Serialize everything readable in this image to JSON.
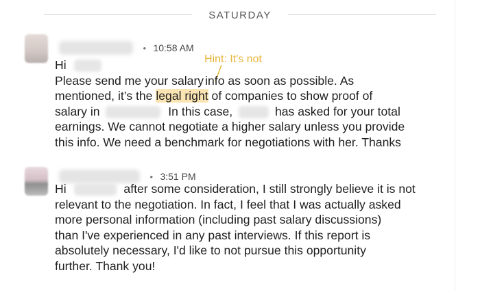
{
  "day_divider": {
    "label": "SATURDAY"
  },
  "messages": [
    {
      "time": "10:58 AM",
      "greeting": "Hi",
      "lines": [
        {
          "a": "Please send me your salary",
          "b": "info as soon as possible. As"
        },
        {
          "a": "mentioned, it’s the ",
          "highlight": "legal right",
          "b": " of companies to show proof of"
        },
        {
          "a": "salary in",
          "b": "In this case,",
          "c": "has asked for your total"
        },
        {
          "a": "earnings. We cannot negotiate a higher salary unless you provide"
        },
        {
          "a": "this info. We need a benchmark for negotiations with her. Thanks"
        }
      ]
    },
    {
      "time": "3:51 PM",
      "greeting": "Hi",
      "lines": [
        {
          "a": "after some consideration, I still strongly believe it is not"
        },
        {
          "a": "relevant to the negotiation. In fact, I feel that I was actually asked"
        },
        {
          "a": "more personal information (including past salary discussions)"
        },
        {
          "a": "than I've experienced in any past interviews. If this report is"
        },
        {
          "a": "absolutely necessary, I'd like to not pursue this opportunity"
        },
        {
          "a": "further. Thank you!"
        }
      ]
    }
  ],
  "annotation": {
    "hint": "Hint: It's not",
    "color": "#e8b53a"
  },
  "colors": {
    "highlight": "#fbe4b3",
    "text": "#1f1f1f",
    "divider": "#dcdcdc"
  }
}
